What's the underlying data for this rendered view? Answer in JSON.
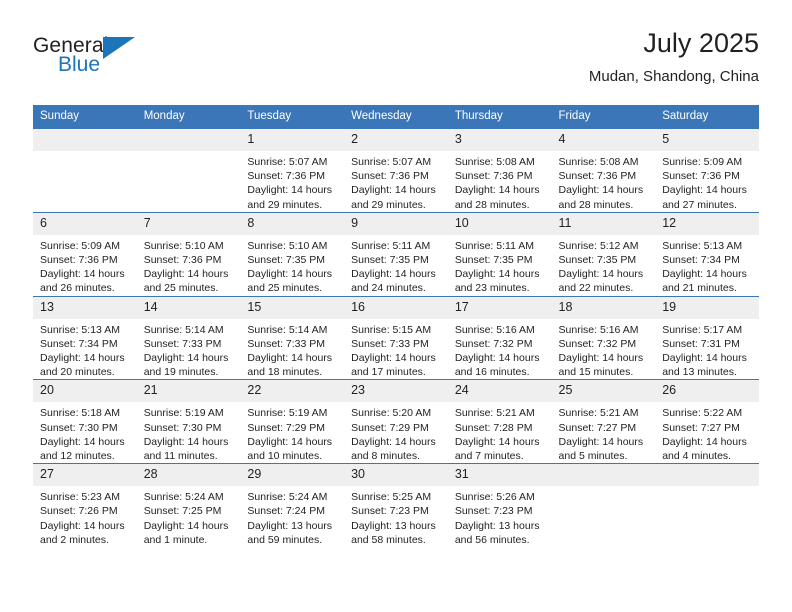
{
  "brand": {
    "name_top": "General",
    "name_bottom": "Blue",
    "triangle_icon": "blue-triangle-icon",
    "accent_color": "#1b75bb"
  },
  "header": {
    "title": "July 2025",
    "location": "Mudan, Shandong, China"
  },
  "theme": {
    "header_bar": "#3b76b8",
    "daynum_band": "#efefef",
    "text": "#231f20"
  },
  "weekdays": [
    "Sunday",
    "Monday",
    "Tuesday",
    "Wednesday",
    "Thursday",
    "Friday",
    "Saturday"
  ],
  "weeks": [
    [
      {
        "day": "",
        "lines": []
      },
      {
        "day": "",
        "lines": []
      },
      {
        "day": "1",
        "lines": [
          "Sunrise: 5:07 AM",
          "Sunset: 7:36 PM",
          "Daylight: 14 hours and 29 minutes."
        ]
      },
      {
        "day": "2",
        "lines": [
          "Sunrise: 5:07 AM",
          "Sunset: 7:36 PM",
          "Daylight: 14 hours and 29 minutes."
        ]
      },
      {
        "day": "3",
        "lines": [
          "Sunrise: 5:08 AM",
          "Sunset: 7:36 PM",
          "Daylight: 14 hours and 28 minutes."
        ]
      },
      {
        "day": "4",
        "lines": [
          "Sunrise: 5:08 AM",
          "Sunset: 7:36 PM",
          "Daylight: 14 hours and 28 minutes."
        ]
      },
      {
        "day": "5",
        "lines": [
          "Sunrise: 5:09 AM",
          "Sunset: 7:36 PM",
          "Daylight: 14 hours and 27 minutes."
        ]
      }
    ],
    [
      {
        "day": "6",
        "lines": [
          "Sunrise: 5:09 AM",
          "Sunset: 7:36 PM",
          "Daylight: 14 hours and 26 minutes."
        ]
      },
      {
        "day": "7",
        "lines": [
          "Sunrise: 5:10 AM",
          "Sunset: 7:36 PM",
          "Daylight: 14 hours and 25 minutes."
        ]
      },
      {
        "day": "8",
        "lines": [
          "Sunrise: 5:10 AM",
          "Sunset: 7:35 PM",
          "Daylight: 14 hours and 25 minutes."
        ]
      },
      {
        "day": "9",
        "lines": [
          "Sunrise: 5:11 AM",
          "Sunset: 7:35 PM",
          "Daylight: 14 hours and 24 minutes."
        ]
      },
      {
        "day": "10",
        "lines": [
          "Sunrise: 5:11 AM",
          "Sunset: 7:35 PM",
          "Daylight: 14 hours and 23 minutes."
        ]
      },
      {
        "day": "11",
        "lines": [
          "Sunrise: 5:12 AM",
          "Sunset: 7:35 PM",
          "Daylight: 14 hours and 22 minutes."
        ]
      },
      {
        "day": "12",
        "lines": [
          "Sunrise: 5:13 AM",
          "Sunset: 7:34 PM",
          "Daylight: 14 hours and 21 minutes."
        ]
      }
    ],
    [
      {
        "day": "13",
        "lines": [
          "Sunrise: 5:13 AM",
          "Sunset: 7:34 PM",
          "Daylight: 14 hours and 20 minutes."
        ]
      },
      {
        "day": "14",
        "lines": [
          "Sunrise: 5:14 AM",
          "Sunset: 7:33 PM",
          "Daylight: 14 hours and 19 minutes."
        ]
      },
      {
        "day": "15",
        "lines": [
          "Sunrise: 5:14 AM",
          "Sunset: 7:33 PM",
          "Daylight: 14 hours and 18 minutes."
        ]
      },
      {
        "day": "16",
        "lines": [
          "Sunrise: 5:15 AM",
          "Sunset: 7:33 PM",
          "Daylight: 14 hours and 17 minutes."
        ]
      },
      {
        "day": "17",
        "lines": [
          "Sunrise: 5:16 AM",
          "Sunset: 7:32 PM",
          "Daylight: 14 hours and 16 minutes."
        ]
      },
      {
        "day": "18",
        "lines": [
          "Sunrise: 5:16 AM",
          "Sunset: 7:32 PM",
          "Daylight: 14 hours and 15 minutes."
        ]
      },
      {
        "day": "19",
        "lines": [
          "Sunrise: 5:17 AM",
          "Sunset: 7:31 PM",
          "Daylight: 14 hours and 13 minutes."
        ]
      }
    ],
    [
      {
        "day": "20",
        "lines": [
          "Sunrise: 5:18 AM",
          "Sunset: 7:30 PM",
          "Daylight: 14 hours and 12 minutes."
        ]
      },
      {
        "day": "21",
        "lines": [
          "Sunrise: 5:19 AM",
          "Sunset: 7:30 PM",
          "Daylight: 14 hours and 11 minutes."
        ]
      },
      {
        "day": "22",
        "lines": [
          "Sunrise: 5:19 AM",
          "Sunset: 7:29 PM",
          "Daylight: 14 hours and 10 minutes."
        ]
      },
      {
        "day": "23",
        "lines": [
          "Sunrise: 5:20 AM",
          "Sunset: 7:29 PM",
          "Daylight: 14 hours and 8 minutes."
        ]
      },
      {
        "day": "24",
        "lines": [
          "Sunrise: 5:21 AM",
          "Sunset: 7:28 PM",
          "Daylight: 14 hours and 7 minutes."
        ]
      },
      {
        "day": "25",
        "lines": [
          "Sunrise: 5:21 AM",
          "Sunset: 7:27 PM",
          "Daylight: 14 hours and 5 minutes."
        ]
      },
      {
        "day": "26",
        "lines": [
          "Sunrise: 5:22 AM",
          "Sunset: 7:27 PM",
          "Daylight: 14 hours and 4 minutes."
        ]
      }
    ],
    [
      {
        "day": "27",
        "lines": [
          "Sunrise: 5:23 AM",
          "Sunset: 7:26 PM",
          "Daylight: 14 hours and 2 minutes."
        ]
      },
      {
        "day": "28",
        "lines": [
          "Sunrise: 5:24 AM",
          "Sunset: 7:25 PM",
          "Daylight: 14 hours and 1 minute."
        ]
      },
      {
        "day": "29",
        "lines": [
          "Sunrise: 5:24 AM",
          "Sunset: 7:24 PM",
          "Daylight: 13 hours and 59 minutes."
        ]
      },
      {
        "day": "30",
        "lines": [
          "Sunrise: 5:25 AM",
          "Sunset: 7:23 PM",
          "Daylight: 13 hours and 58 minutes."
        ]
      },
      {
        "day": "31",
        "lines": [
          "Sunrise: 5:26 AM",
          "Sunset: 7:23 PM",
          "Daylight: 13 hours and 56 minutes."
        ]
      },
      {
        "day": "",
        "lines": []
      },
      {
        "day": "",
        "lines": []
      }
    ]
  ]
}
